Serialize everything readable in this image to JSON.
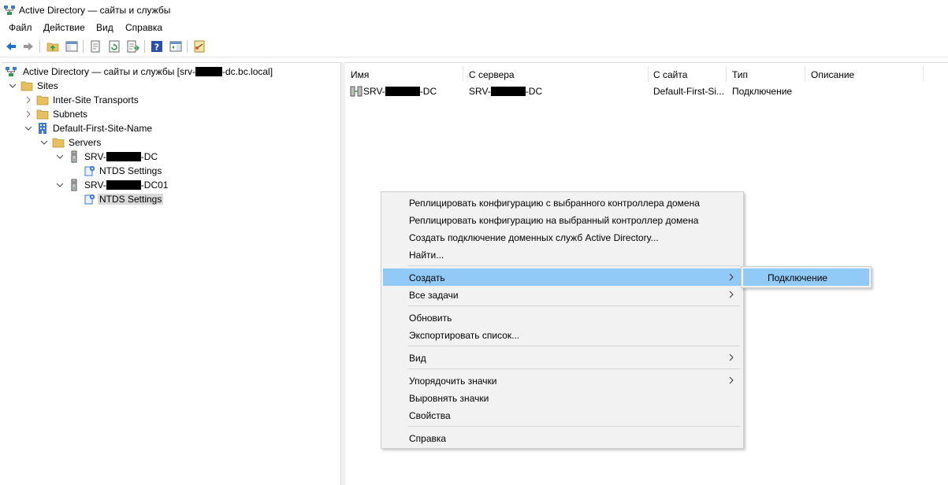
{
  "window": {
    "title": "Active Directory — сайты и службы"
  },
  "menu": [
    "Файл",
    "Действие",
    "Вид",
    "Справка"
  ],
  "toolbar_icons": [
    "back-arrow-icon",
    "forward-arrow-icon",
    "up-folder-icon",
    "show-hide-tree-icon",
    "properties-icon",
    "refresh-icon",
    "export-list-icon",
    "help-icon",
    "show-hide-action-pane-icon",
    "connect-icon"
  ],
  "tree": {
    "root_prefix": "Active Directory — сайты и службы [srv-",
    "root_suffix": "-dc.bc.local]",
    "sites": "Sites",
    "inter_site": "Inter-Site Transports",
    "subnets": "Subnets",
    "site_name": "Default-First-Site-Name",
    "servers": "Servers",
    "srv_prefix": "SRV-",
    "srv1_suffix": "-DC",
    "srv2_suffix": "-DC01",
    "ntds1": "NTDS Settings",
    "ntds2": "NTDS Settings"
  },
  "list": {
    "columns": [
      "Имя",
      "С сервера",
      "С сайта",
      "Тип",
      "Описание"
    ],
    "row": {
      "name_prefix": "SRV-",
      "name_suffix": "-DC",
      "from_prefix": "SRV-",
      "from_suffix": "-DC",
      "site": "Default-First-Si...",
      "type": "Подключение",
      "description": ""
    }
  },
  "context_menu": {
    "replicate_from": "Реплицировать конфигурацию с выбранного контроллера домена",
    "replicate_to": "Реплицировать конфигурацию на выбранный контроллер домена",
    "create_connection": "Создать подключение доменных служб Active Directory...",
    "find": "Найти...",
    "create": "Создать",
    "all_tasks": "Все задачи",
    "refresh": "Обновить",
    "export": "Экспортировать список...",
    "view": "Вид",
    "arrange": "Упорядочить значки",
    "align": "Выровнять значки",
    "properties": "Свойства",
    "help": "Справка"
  },
  "submenu": {
    "connection": "Подключение"
  },
  "colors": {
    "highlight": "#91c9f7",
    "menu_bg": "#f2f2f2",
    "selected_tree": "#d9d9d9",
    "folder": "#e8c060",
    "accent_blue": "#1a73c8"
  }
}
